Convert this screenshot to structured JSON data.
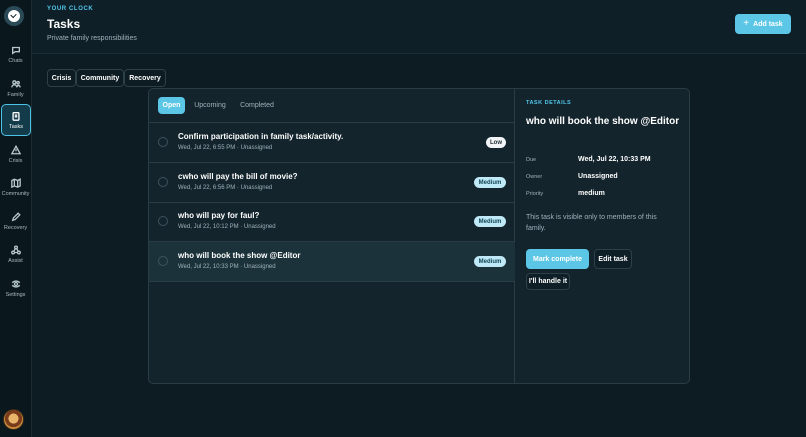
{
  "sidebar": {
    "items": [
      {
        "label": "Chats",
        "icon": "chat-icon"
      },
      {
        "label": "Family",
        "icon": "family-icon"
      },
      {
        "label": "Tasks",
        "icon": "clipboard-icon"
      },
      {
        "label": "Crisis",
        "icon": "warning-icon"
      },
      {
        "label": "Community",
        "icon": "map-icon"
      },
      {
        "label": "Recovery",
        "icon": "pen-icon"
      },
      {
        "label": "Assist",
        "icon": "molecule-icon"
      },
      {
        "label": "Settings",
        "icon": "settings-icon"
      }
    ],
    "active": "Tasks"
  },
  "header": {
    "eyebrow": "YOUR CLOCK",
    "title": "Tasks",
    "subtitle": "Private family responsibilities",
    "add_button": "Add task"
  },
  "segments": [
    "Crisis",
    "Community",
    "Recovery"
  ],
  "filters": {
    "tabs": [
      "Open",
      "Upcoming",
      "Completed"
    ],
    "active": "Open"
  },
  "tasks": [
    {
      "title": "Confirm participation in family task/activity.",
      "meta": "Wed, Jul 22, 6:55 PM · Unassigned",
      "priority": "Low"
    },
    {
      "title": "cwho will pay the bill of movie?",
      "meta": "Wed, Jul 22, 6:56 PM · Unassigned",
      "priority": "Medium"
    },
    {
      "title": "who will pay for faul?",
      "meta": "Wed, Jul 22, 10:12 PM · Unassigned",
      "priority": "Medium"
    },
    {
      "title": "who will book the show @Editor",
      "meta": "Wed, Jul 22, 10:33 PM · Unassigned",
      "priority": "Medium",
      "selected": true
    }
  ],
  "detail": {
    "eyebrow": "TASK DETAILS",
    "title": "who will book the show @Editor",
    "due_label": "Due",
    "due_value": "Wed, Jul 22, 10:33 PM",
    "owner_label": "Owner",
    "owner_value": "Unassigned",
    "priority_label": "Priority",
    "priority_value": "medium",
    "note": "This task is visible only to members of this family.",
    "mark_complete": "Mark complete",
    "edit_task": "Edit task",
    "handle_it": "I'll handle it"
  },
  "colors": {
    "accent": "#5cc6e6",
    "background": "#0d1b22",
    "card": "#13242c"
  }
}
